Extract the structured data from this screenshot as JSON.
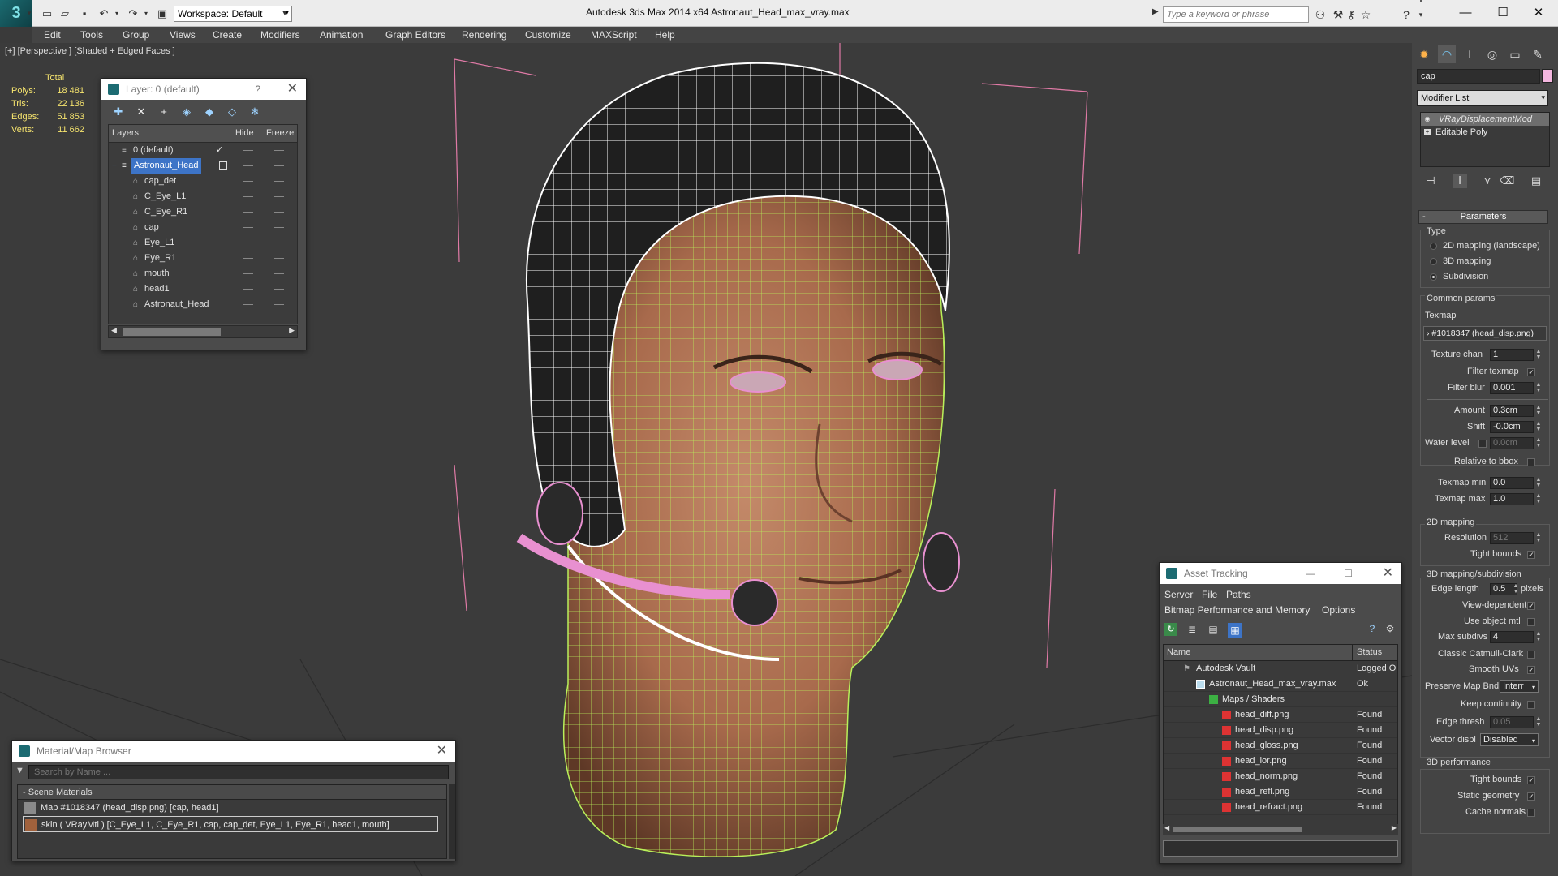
{
  "titlebar": {
    "workspace": "Workspace: Default",
    "title": "Autodesk 3ds Max  2014 x64      Astronaut_Head_max_vray.max",
    "search_placeholder": "Type a keyword or phrase"
  },
  "menu": [
    "Edit",
    "Tools",
    "Group",
    "Views",
    "Create",
    "Modifiers",
    "Animation",
    "Graph Editors",
    "Rendering",
    "Customize",
    "MAXScript",
    "Help"
  ],
  "viewport": {
    "label": "[+] [Perspective ] [Shaded + Edged Faces ]",
    "stats": {
      "header": "Total",
      "rows": [
        {
          "label": "Polys:",
          "value": "18 481"
        },
        {
          "label": "Tris:",
          "value": "22 136"
        },
        {
          "label": "Edges:",
          "value": "51 853"
        },
        {
          "label": "Verts:",
          "value": "11 662"
        }
      ]
    }
  },
  "layer_window": {
    "title": "Layer: 0 (default)",
    "help": "?",
    "columns": {
      "layers": "Layers",
      "hide": "Hide",
      "freeze": "Freeze"
    },
    "rows": [
      {
        "name": "0 (default)",
        "level": 0,
        "current": true
      },
      {
        "name": "Astronaut_Head",
        "level": 0,
        "selected": true
      },
      {
        "name": "cap_det",
        "level": 1
      },
      {
        "name": "C_Eye_L1",
        "level": 1
      },
      {
        "name": "C_Eye_R1",
        "level": 1
      },
      {
        "name": "cap",
        "level": 1
      },
      {
        "name": "Eye_L1",
        "level": 1
      },
      {
        "name": "Eye_R1",
        "level": 1
      },
      {
        "name": "mouth",
        "level": 1
      },
      {
        "name": "head1",
        "level": 1
      },
      {
        "name": "Astronaut_Head",
        "level": 1
      }
    ]
  },
  "material_browser": {
    "title": "Material/Map Browser",
    "search_placeholder": "Search by Name ...",
    "section": "Scene Materials",
    "items": [
      {
        "text": "Map #1018347 (head_disp.png)  [cap, head1]",
        "swatch": "#8a8a8a"
      },
      {
        "text": "skin  ( VRayMtl )  [C_Eye_L1, C_Eye_R1, cap, cap_det, Eye_L1, Eye_R1, head1, mouth]",
        "swatch": "#a0613c"
      }
    ]
  },
  "asset_tracking": {
    "title": "Asset Tracking",
    "menu1": [
      "Server",
      "File",
      "Paths"
    ],
    "menu2": [
      "Bitmap Performance and Memory",
      "Options"
    ],
    "columns": {
      "name": "Name",
      "status": "Status"
    },
    "rows": [
      {
        "name": "Autodesk Vault",
        "status": "Logged O",
        "level": 0
      },
      {
        "name": "Astronaut_Head_max_vray.max",
        "status": "Ok",
        "level": 1
      },
      {
        "name": "Maps / Shaders",
        "status": "",
        "level": 2
      },
      {
        "name": "head_diff.png",
        "status": "Found",
        "level": 3
      },
      {
        "name": "head_disp.png",
        "status": "Found",
        "level": 3
      },
      {
        "name": "head_gloss.png",
        "status": "Found",
        "level": 3
      },
      {
        "name": "head_ior.png",
        "status": "Found",
        "level": 3
      },
      {
        "name": "head_norm.png",
        "status": "Found",
        "level": 3
      },
      {
        "name": "head_refl.png",
        "status": "Found",
        "level": 3
      },
      {
        "name": "head_refract.png",
        "status": "Found",
        "level": 3
      }
    ]
  },
  "command_panel": {
    "object_name": "cap",
    "object_color": "#f4b7e0",
    "modifier_list": "Modifier List",
    "stack": [
      "VRayDisplacementMod",
      "Editable Poly"
    ],
    "parameters": {
      "title": "Parameters",
      "type_group": "Type",
      "type_options": [
        "2D mapping (landscape)",
        "3D mapping",
        "Subdivision"
      ],
      "common_group": "Common params",
      "texmap_label": "Texmap",
      "texmap_value": "› #1018347 (head_disp.png)",
      "texture_chan_label": "Texture chan",
      "texture_chan": "1",
      "filter_texmap_label": "Filter texmap",
      "filter_blur_label": "Filter blur",
      "filter_blur": "0.001",
      "amount_label": "Amount",
      "amount": "0.3cm",
      "shift_label": "Shift",
      "shift": "-0.0cm",
      "water_level_label": "Water level",
      "water_level": "0.0cm",
      "relative_bbox_label": "Relative to bbox",
      "texmap_min_label": "Texmap min",
      "texmap_min": "0.0",
      "texmap_max_label": "Texmap max",
      "texmap_max": "1.0",
      "mapping2d_group": "2D mapping",
      "resolution_label": "Resolution",
      "resolution": "512",
      "tight_bounds_label": "Tight bounds",
      "mapping3d_group": "3D mapping/subdivision",
      "edge_length_label": "Edge length",
      "edge_length": "0.5",
      "pixels_label": "pixels",
      "view_dependent_label": "View-dependent",
      "use_object_mtl_label": "Use object mtl",
      "max_subdivs_label": "Max subdivs",
      "max_subdivs": "4",
      "classic_cc_label": "Classic Catmull-Clark",
      "smooth_uvs_label": "Smooth UVs",
      "preserve_map_label": "Preserve Map Bnd",
      "preserve_map": "Interr",
      "keep_continuity_label": "Keep continuity",
      "edge_thresh_label": "Edge thresh",
      "edge_thresh": "0.05",
      "vector_displ_label": "Vector displ",
      "vector_displ": "Disabled",
      "perf_group": "3D performance",
      "tight_bounds2_label": "Tight bounds",
      "static_geometry_label": "Static geometry",
      "cache_normals_label": "Cache normals"
    }
  }
}
